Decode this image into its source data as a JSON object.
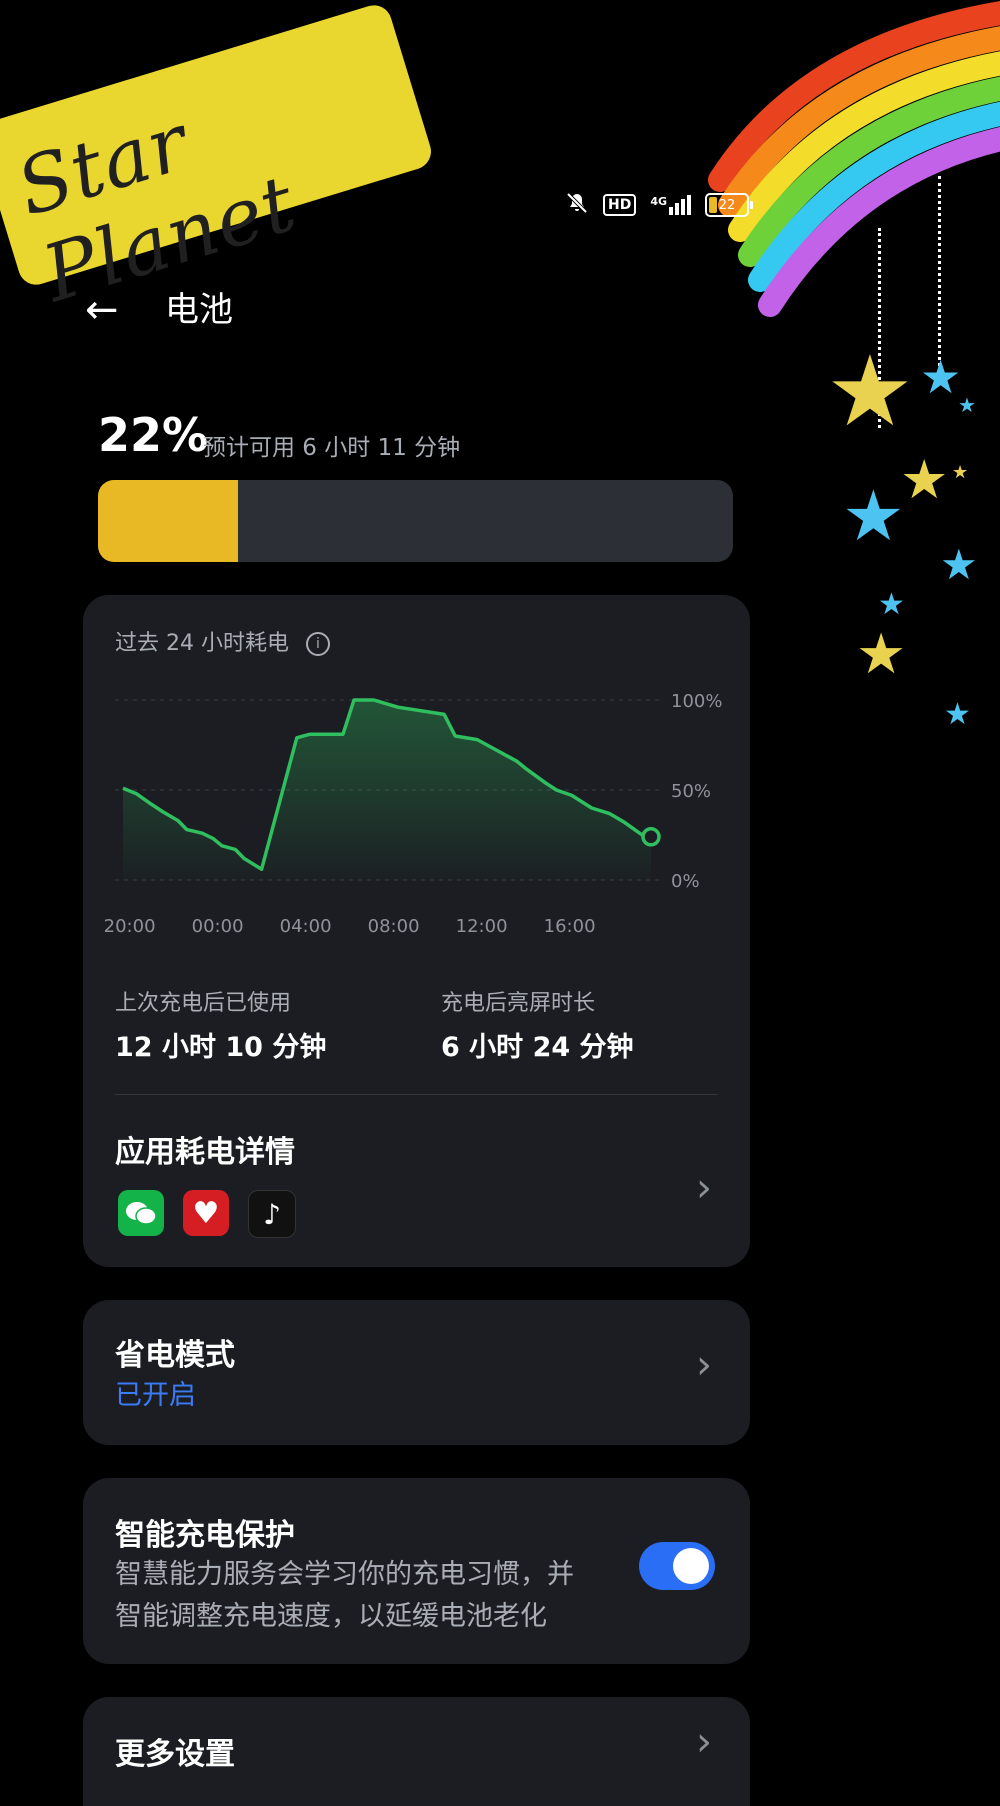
{
  "decor": {
    "sticker_text": "Star Planet"
  },
  "status_bar": {
    "icons": [
      "mute-icon",
      "hd-icon",
      "signal-4g-icon",
      "battery-icon"
    ],
    "hd_label": "HD",
    "network_label": "4G",
    "battery_level": "22",
    "battery_fraction": 0.22
  },
  "header": {
    "back_icon": "←",
    "title": "电池"
  },
  "battery": {
    "percent_text": "22%",
    "remaining_text": "预计可用 6 小时 11 分钟",
    "level": 0.22,
    "fill_color": "#e8b825"
  },
  "usage_card": {
    "title": "过去 24 小时耗电",
    "info_icon": "i",
    "stats": [
      {
        "label": "上次充电后已使用",
        "value": "12 小时 10 分钟"
      },
      {
        "label": "充电后亮屏时长",
        "value": "6 小时 24 分钟"
      }
    ],
    "apps_title": "应用耗电详情",
    "apps": [
      "wechat-icon",
      "pinduoduo-icon",
      "douyin-icon"
    ],
    "chevron": "›"
  },
  "chart_data": {
    "type": "area",
    "title": "",
    "xlabel": "",
    "ylabel": "",
    "x_ticks": [
      "20:00",
      "00:00",
      "04:00",
      "08:00",
      "12:00",
      "16:00"
    ],
    "y_ticks": [
      "100%",
      "50%",
      "0%"
    ],
    "xlim": [
      -0.3,
      23.7
    ],
    "ylim": [
      0,
      100
    ],
    "grid": true,
    "line_color": "#2fbf5f",
    "x": [
      -0.3,
      0.3,
      1,
      1.5,
      2.2,
      2.6,
      3.3,
      3.8,
      4.2,
      4.8,
      5.2,
      6.0,
      7.6,
      8.2,
      9.7,
      10.2,
      11.1,
      12.2,
      14.3,
      14.8,
      15.8,
      17.6,
      18.0,
      18.9,
      19.4,
      20.1,
      21.0,
      21.8,
      22.5,
      23.3,
      23.7
    ],
    "values": [
      51,
      48,
      42,
      38,
      33,
      28,
      26,
      23,
      19,
      17,
      12,
      6,
      79,
      81,
      81,
      100,
      100,
      96,
      92,
      80,
      78,
      66,
      62,
      54,
      50,
      47,
      40,
      37,
      32,
      25,
      24
    ],
    "end_marker": true
  },
  "power_saving": {
    "title": "省电模式",
    "status": "已开启",
    "status_color": "#3a7cf6",
    "chevron": "›"
  },
  "smart_charging": {
    "title": "智能充电保护",
    "description_line1": "智慧能力服务会学习你的充电习惯，并",
    "description_line2": "智能调整充电速度，以延缓电池老化",
    "enabled": true
  },
  "more_settings": {
    "title": "更多设置",
    "chevron": "›"
  }
}
